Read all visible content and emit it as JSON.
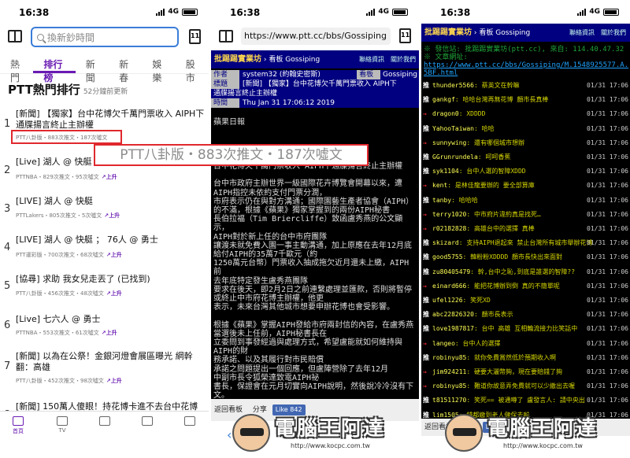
{
  "status": {
    "time": "16:38",
    "network": "4G"
  },
  "panel1": {
    "search_placeholder": "換新鈔時間",
    "tabs_badge": "11",
    "tabs": [
      "熱門",
      "排行榜",
      "新聞",
      "新春",
      "娛樂",
      "股市"
    ],
    "title": "PTT熱門排行",
    "updated": "52分鐘前更新",
    "items": [
      {
        "num": "1",
        "head": "[新聞] 【獨家】台中花博欠千萬門票收入 AIPH下通牒揚言終止主辦權",
        "meta": "PTT八卦版・883次推文・187次噓文",
        "up": ""
      },
      {
        "num": "2",
        "head": "[Live] 湖人 @ 快艇",
        "meta": "PTTNBA・829次推文・95次噓文",
        "up": "上升"
      },
      {
        "num": "3",
        "head": "[LIVE] 湖人 @ 快艇",
        "meta": "PTTLakers・805次推文・5次噓文",
        "up": "上升"
      },
      {
        "num": "4",
        "head": "[LIVE] 湖人 @ 快艇 ； 76人 @ 勇士",
        "meta": "PTT運彩版・700次推文・68次噓文",
        "up": "上升"
      },
      {
        "num": "5",
        "head": "[協尋] 求助 我女兒走丟了 (已找到)",
        "meta": "PTT八卦版・456次推文・48次噓文",
        "up": "上升"
      },
      {
        "num": "6",
        "head": "[Live] 七六人 @ 勇士",
        "meta": "PTTNBA・553次推文・61次噓文",
        "up": "上升"
      },
      {
        "num": "7",
        "head": "[新聞] 以為在公祭！金銀河燈會展區曝光 網幹翻：高雄",
        "meta": "PTT八卦版・452次推文・98次噓文",
        "up": "上升"
      },
      {
        "num": "8",
        "head": "[新聞] 150萬人傻眼！持花博卡進不去台中花博",
        "meta": "",
        "up": ""
      }
    ],
    "callout": "PTT八卦版・883次推文・187次噓文",
    "bottom_nav": [
      "首頁",
      "TV",
      "",
      "",
      ""
    ]
  },
  "panel2": {
    "url": "https://www.ptt.cc/bbs/Gossiping",
    "bar": {
      "brand": "批踢踢實業坊",
      "board_prefix": "›",
      "board": "看板 Gossiping",
      "link1": "聯絡資訊",
      "link2": "關於我們"
    },
    "header": [
      {
        "label": "作者",
        "value": "system32 (約翰史密斯)",
        "label2": "看板",
        "value2": "Gossiping"
      },
      {
        "label": "標題",
        "value": "[新聞] 【獨家】台中花博欠千萬門票收入 AIPH下",
        "label2": "",
        "value2": ""
      },
      {
        "label": "通牒揚言終止主辦權",
        "value": "",
        "label2": "",
        "value2": ""
      },
      {
        "label": "時間",
        "value": "Thu Jan 31 17:06:12 2019",
        "label2": "",
        "value2": ""
      }
    ],
    "body": "蘋果日報\n\n\n\n\n台中花博欠千萬門票收入 AIPH下通牒揚言終止主辦權\n\n台中市政府主辦世界一級國際花卉博覽會開幕以來，遭AIPH指控未依約支付門票分潤，\n市府表示仍在與對方溝通；國際園藝生產者協會（AIPH）\n的不滿，根據《蘋果》獨家掌握到的兩份AIPH秘書\n長伯拉福（Tim Briercliffe）致函盧秀燕的公文顯示，\nAIPH對於新上任的台中市府團隊\n讓渡未就免費入園一事主動溝通，加上原應在去年12月底\n給付AIPH的35萬7千歐元（約\n1250萬元台幣）門票收入抽成拖欠近月還未上繳，AIPH前\n去年底特定發生盧秀燕團隊\n要求在後天，即2月2日之前連繫處理並匯款，否則將暫停\n或終止中市府花博主辦權，他更\n表示，未來台灣其他城市想要申辦花博也會受影響。\n\n根據《蘋果》掌握AIPH發給市府兩封信的內容，在盧秀燕\n當選後未上任前，AIPH秘書長在\n立委問到事發經過與處理方式，希望盧能就如何維持與AIPH的財\n務承諾、以及其履行對市民賠償\n承諾之問題提出一個回應，但盧陣營除了去年12月\n中副市長令狐榮達致電AIPH祕\n書長，保證會在元月切實向AIPH說明，然後說冷冷沒有下文。\nAIPH執行委員會前天再次發文盧秀\n燕，要求中市府在2/2前針對免收門票新政策提出說明，同\n時確認原契約要求，即須在去\n年12月底支付附約第25條台中市花博門票收入的1%門票抽成的一\n半金額，即35萬7千歐元，相當",
    "actions": {
      "back": "返回看板",
      "share": "分享",
      "like": "Like 842"
    }
  },
  "panel3": {
    "bar": {
      "brand": "批踢踢實業坊",
      "board_prefix": "›",
      "board": "看板 Gossiping",
      "link1": "聯絡資訊",
      "link2": "關於我們"
    },
    "sys1": "※ 發信站: 批踢踢實業坊(ptt.cc), 來自: 114.40.47.32",
    "sys2": "※ 文章網址:",
    "sys3": "https://www.ptt.cc/bbs/Gossiping/M.1548925577.A.5BF.html",
    "pushes": [
      {
        "tag": "推",
        "user": "thunder5566",
        "text": ": 蔡英文在幹嘛",
        "time": "01/31 17:06"
      },
      {
        "tag": "推",
        "user": "gankgf",
        "text": ": 哈哈台灣再無花博 顏市長真棒",
        "time": "01/31 17:06"
      },
      {
        "tag": "→",
        "user": "dragon0",
        "text": ": XDDDD",
        "time": "01/31 17:06"
      },
      {
        "tag": "推",
        "user": "YahooTaiwan",
        "text": ": 哈哈",
        "time": "01/31 17:06"
      },
      {
        "tag": "→",
        "user": "sunnywing",
        "text": ": 還有哪個城市想辦",
        "time": "01/31 17:06"
      },
      {
        "tag": "推",
        "user": "GGrunrundela",
        "text": ": 呵呵香蕉",
        "time": "01/31 17:06"
      },
      {
        "tag": "推",
        "user": "syk1104",
        "text": ": 台中人選的智障XDDD",
        "time": "01/31 17:06"
      },
      {
        "tag": "→",
        "user": "kent",
        "text": ": 是林佳龍要辦的 要全部算庫",
        "time": "01/31 17:06"
      },
      {
        "tag": "推",
        "user": "tanby",
        "text": ": 哈哈哈",
        "time": "01/31 17:06"
      },
      {
        "tag": "→",
        "user": "terry1020",
        "text": ": 中市府片違約真是找死…",
        "time": "01/31 17:06"
      },
      {
        "tag": "→",
        "user": "r02182828",
        "text": ": 高雄台中的選擇 真棒",
        "time": "01/31 17:06"
      },
      {
        "tag": "推",
        "user": "skizard",
        "text": ": 支持AIPH退起來 禁止台灣所有城市舉辦花博",
        "time": "01/31 17:06"
      },
      {
        "tag": "推",
        "user": "good5755",
        "text": ": 韓粉粉XDDDD 顏市長快出來面對",
        "time": "01/31 17:06"
      },
      {
        "tag": "推",
        "user": "zu80405479",
        "text": ": 幹,台中之恥,到底是誰選的智障??",
        "time": "01/31 17:06"
      },
      {
        "tag": "→",
        "user": "einard666",
        "text": ": 能把花博辦到倒 真的不簡單呢",
        "time": "01/31 17:06"
      },
      {
        "tag": "推",
        "user": "ufel1226",
        "text": ": 笑死XD",
        "time": "01/31 17:06"
      },
      {
        "tag": "推",
        "user": "abc22826320",
        "text": ": 顏市長表示",
        "time": "01/31 17:06"
      },
      {
        "tag": "推",
        "user": "love1987817",
        "text": ": 台中 高雄 互相輪流接力比笑話中",
        "time": "01/31 17:06"
      },
      {
        "tag": "→",
        "user": "langeo",
        "text": ": 台中人的選擇",
        "time": "01/31 17:06"
      },
      {
        "tag": "推",
        "user": "robinyu85",
        "text": ": 就你免費賞然低於預期收入啊",
        "time": "01/31 17:06"
      },
      {
        "tag": "→",
        "user": "jim924211",
        "text": ": 硬要大灑幣夠，現在要賠錢了夠",
        "time": "01/31 17:06"
      },
      {
        "tag": "→",
        "user": "robinyu85",
        "text": ": 難道你故意弄免費就可以少繳出去喔",
        "time": "01/31 17:06"
      },
      {
        "tag": "推",
        "user": "t81511270",
        "text": ": 笑死== 被通噂了 盧發言人: 請中央出",
        "time": "01/31 17:06"
      },
      {
        "tag": "推",
        "user": "lim1505",
        "text": ": 錢都繳到老人健保去啦",
        "time": "01/31 17:06"
      }
    ],
    "actions": {
      "back": "返回看板",
      "share": "分享",
      "like": "Like"
    }
  },
  "watermark": {
    "text": "電腦王阿達",
    "url": "http://www.kocpc.com.tw"
  }
}
